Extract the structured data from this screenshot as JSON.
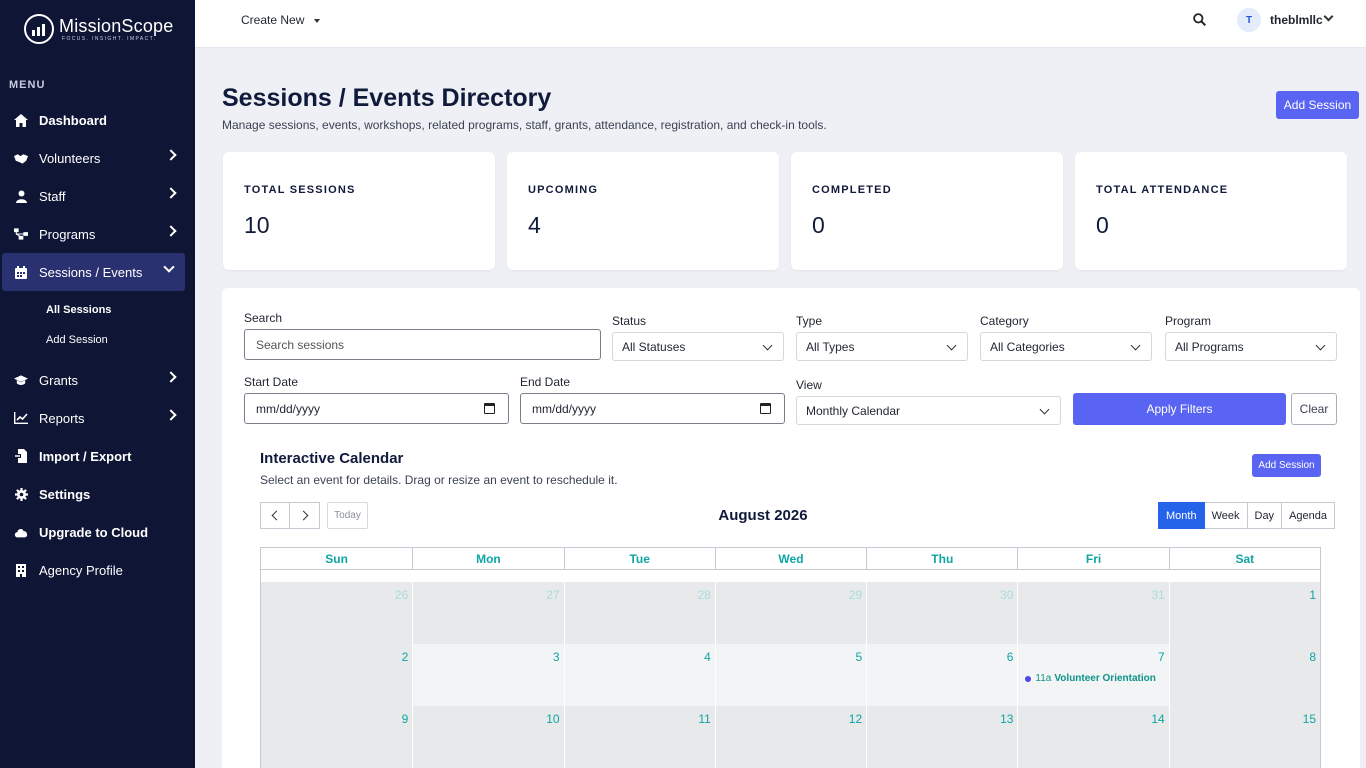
{
  "brand": {
    "name": "MissionScope",
    "tagline": "FOCUS. INSIGHT. IMPACT."
  },
  "sidebar": {
    "menu_label": "MENU",
    "items": [
      {
        "label": "Dashboard",
        "icon": "home-icon"
      },
      {
        "label": "Volunteers",
        "icon": "handshake-icon"
      },
      {
        "label": "Staff",
        "icon": "user-icon"
      },
      {
        "label": "Programs",
        "icon": "sitemap-icon"
      },
      {
        "label": "Sessions / Events",
        "icon": "calendar-icon"
      },
      {
        "label": "Grants",
        "icon": "graduation-cap-icon"
      },
      {
        "label": "Reports",
        "icon": "line-chart-icon"
      },
      {
        "label": "Import / Export",
        "icon": "file-import-icon"
      },
      {
        "label": "Settings",
        "icon": "gear-icon"
      },
      {
        "label": "Upgrade to Cloud",
        "icon": "cloud-icon"
      },
      {
        "label": "Agency Profile",
        "icon": "building-icon"
      }
    ],
    "sub_items": [
      "All Sessions",
      "Add Session"
    ]
  },
  "topbar": {
    "create_new": "Create New",
    "avatar_initial": "T",
    "user_name": "theblmllc"
  },
  "page": {
    "title": "Sessions / Events Directory",
    "subtitle": "Manage sessions, events, workshops, related programs, staff, grants, attendance, registration, and check-in tools.",
    "add_session": "Add Session"
  },
  "stats": [
    {
      "label": "TOTAL SESSIONS",
      "value": "10"
    },
    {
      "label": "UPCOMING",
      "value": "4"
    },
    {
      "label": "COMPLETED",
      "value": "0"
    },
    {
      "label": "TOTAL ATTENDANCE",
      "value": "0"
    }
  ],
  "filters": {
    "search_label": "Search",
    "search_placeholder": "Search sessions",
    "status_label": "Status",
    "status_value": "All Statuses",
    "type_label": "Type",
    "type_value": "All Types",
    "category_label": "Category",
    "category_value": "All Categories",
    "program_label": "Program",
    "program_value": "All Programs",
    "start_label": "Start Date",
    "start_value": "mm/dd/yyyy",
    "end_label": "End Date",
    "end_value": "mm/dd/yyyy",
    "view_label": "View",
    "view_value": "Monthly Calendar",
    "apply": "Apply Filters",
    "clear": "Clear"
  },
  "calendar": {
    "title": "Interactive Calendar",
    "subtitle": "Select an event for details. Drag or resize an event to reschedule it.",
    "add_session": "Add Session",
    "today": "Today",
    "month": "August 2026",
    "views": [
      "Month",
      "Week",
      "Day",
      "Agenda"
    ],
    "weekdays": [
      "Sun",
      "Mon",
      "Tue",
      "Wed",
      "Thu",
      "Fri",
      "Sat"
    ],
    "weeks": [
      [
        "26",
        "27",
        "28",
        "29",
        "30",
        "31",
        "1"
      ],
      [
        "2",
        "3",
        "4",
        "5",
        "6",
        "7",
        "8"
      ],
      [
        "9",
        "10",
        "11",
        "12",
        "13",
        "14",
        "15"
      ]
    ],
    "event": {
      "time": "11a",
      "name": "Volunteer Orientation"
    }
  }
}
